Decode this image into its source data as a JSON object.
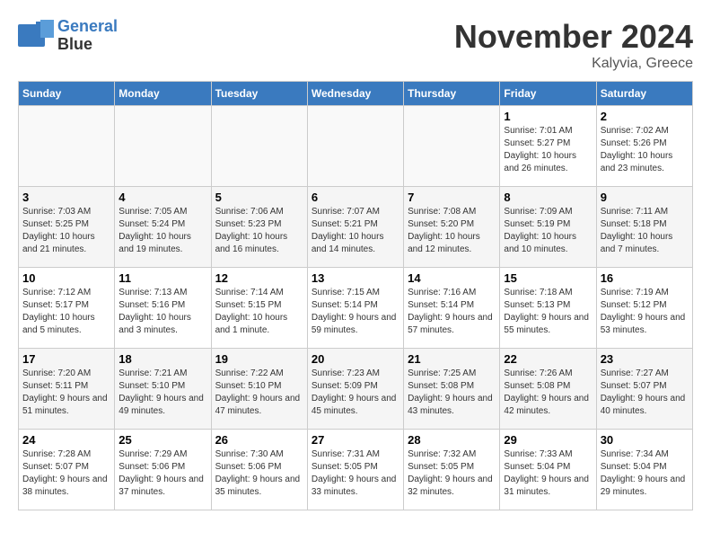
{
  "header": {
    "logo_line1": "General",
    "logo_line2": "Blue",
    "month_title": "November 2024",
    "location": "Kalyvia, Greece"
  },
  "weekdays": [
    "Sunday",
    "Monday",
    "Tuesday",
    "Wednesday",
    "Thursday",
    "Friday",
    "Saturday"
  ],
  "weeks": [
    [
      {
        "day": "",
        "info": ""
      },
      {
        "day": "",
        "info": ""
      },
      {
        "day": "",
        "info": ""
      },
      {
        "day": "",
        "info": ""
      },
      {
        "day": "",
        "info": ""
      },
      {
        "day": "1",
        "info": "Sunrise: 7:01 AM\nSunset: 5:27 PM\nDaylight: 10 hours and 26 minutes."
      },
      {
        "day": "2",
        "info": "Sunrise: 7:02 AM\nSunset: 5:26 PM\nDaylight: 10 hours and 23 minutes."
      }
    ],
    [
      {
        "day": "3",
        "info": "Sunrise: 7:03 AM\nSunset: 5:25 PM\nDaylight: 10 hours and 21 minutes."
      },
      {
        "day": "4",
        "info": "Sunrise: 7:05 AM\nSunset: 5:24 PM\nDaylight: 10 hours and 19 minutes."
      },
      {
        "day": "5",
        "info": "Sunrise: 7:06 AM\nSunset: 5:23 PM\nDaylight: 10 hours and 16 minutes."
      },
      {
        "day": "6",
        "info": "Sunrise: 7:07 AM\nSunset: 5:21 PM\nDaylight: 10 hours and 14 minutes."
      },
      {
        "day": "7",
        "info": "Sunrise: 7:08 AM\nSunset: 5:20 PM\nDaylight: 10 hours and 12 minutes."
      },
      {
        "day": "8",
        "info": "Sunrise: 7:09 AM\nSunset: 5:19 PM\nDaylight: 10 hours and 10 minutes."
      },
      {
        "day": "9",
        "info": "Sunrise: 7:11 AM\nSunset: 5:18 PM\nDaylight: 10 hours and 7 minutes."
      }
    ],
    [
      {
        "day": "10",
        "info": "Sunrise: 7:12 AM\nSunset: 5:17 PM\nDaylight: 10 hours and 5 minutes."
      },
      {
        "day": "11",
        "info": "Sunrise: 7:13 AM\nSunset: 5:16 PM\nDaylight: 10 hours and 3 minutes."
      },
      {
        "day": "12",
        "info": "Sunrise: 7:14 AM\nSunset: 5:15 PM\nDaylight: 10 hours and 1 minute."
      },
      {
        "day": "13",
        "info": "Sunrise: 7:15 AM\nSunset: 5:14 PM\nDaylight: 9 hours and 59 minutes."
      },
      {
        "day": "14",
        "info": "Sunrise: 7:16 AM\nSunset: 5:14 PM\nDaylight: 9 hours and 57 minutes."
      },
      {
        "day": "15",
        "info": "Sunrise: 7:18 AM\nSunset: 5:13 PM\nDaylight: 9 hours and 55 minutes."
      },
      {
        "day": "16",
        "info": "Sunrise: 7:19 AM\nSunset: 5:12 PM\nDaylight: 9 hours and 53 minutes."
      }
    ],
    [
      {
        "day": "17",
        "info": "Sunrise: 7:20 AM\nSunset: 5:11 PM\nDaylight: 9 hours and 51 minutes."
      },
      {
        "day": "18",
        "info": "Sunrise: 7:21 AM\nSunset: 5:10 PM\nDaylight: 9 hours and 49 minutes."
      },
      {
        "day": "19",
        "info": "Sunrise: 7:22 AM\nSunset: 5:10 PM\nDaylight: 9 hours and 47 minutes."
      },
      {
        "day": "20",
        "info": "Sunrise: 7:23 AM\nSunset: 5:09 PM\nDaylight: 9 hours and 45 minutes."
      },
      {
        "day": "21",
        "info": "Sunrise: 7:25 AM\nSunset: 5:08 PM\nDaylight: 9 hours and 43 minutes."
      },
      {
        "day": "22",
        "info": "Sunrise: 7:26 AM\nSunset: 5:08 PM\nDaylight: 9 hours and 42 minutes."
      },
      {
        "day": "23",
        "info": "Sunrise: 7:27 AM\nSunset: 5:07 PM\nDaylight: 9 hours and 40 minutes."
      }
    ],
    [
      {
        "day": "24",
        "info": "Sunrise: 7:28 AM\nSunset: 5:07 PM\nDaylight: 9 hours and 38 minutes."
      },
      {
        "day": "25",
        "info": "Sunrise: 7:29 AM\nSunset: 5:06 PM\nDaylight: 9 hours and 37 minutes."
      },
      {
        "day": "26",
        "info": "Sunrise: 7:30 AM\nSunset: 5:06 PM\nDaylight: 9 hours and 35 minutes."
      },
      {
        "day": "27",
        "info": "Sunrise: 7:31 AM\nSunset: 5:05 PM\nDaylight: 9 hours and 33 minutes."
      },
      {
        "day": "28",
        "info": "Sunrise: 7:32 AM\nSunset: 5:05 PM\nDaylight: 9 hours and 32 minutes."
      },
      {
        "day": "29",
        "info": "Sunrise: 7:33 AM\nSunset: 5:04 PM\nDaylight: 9 hours and 31 minutes."
      },
      {
        "day": "30",
        "info": "Sunrise: 7:34 AM\nSunset: 5:04 PM\nDaylight: 9 hours and 29 minutes."
      }
    ]
  ]
}
